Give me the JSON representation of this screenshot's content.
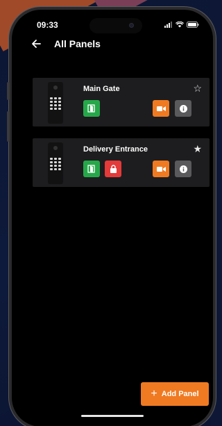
{
  "status": {
    "time": "09:33",
    "icons": [
      "signal-icon",
      "wifi-icon",
      "battery-icon"
    ]
  },
  "header": {
    "back_icon": "arrow-left-icon",
    "title": "All Panels"
  },
  "panels": [
    {
      "name": "Main Gate",
      "favorite": false,
      "star_glyph": "☆",
      "actions": [
        "door-open",
        "video-camera",
        "info"
      ]
    },
    {
      "name": "Delivery Entrance",
      "favorite": true,
      "star_glyph": "★",
      "actions": [
        "door-open",
        "lock",
        "video-camera",
        "info"
      ]
    }
  ],
  "fab": {
    "icon_glyph": "+",
    "label": "Add Panel"
  },
  "colors": {
    "accent": "#f07a22",
    "open": "#26a84a",
    "lock": "#e43a3a",
    "info": "#5a5a5c",
    "card": "#1d1d1f"
  }
}
